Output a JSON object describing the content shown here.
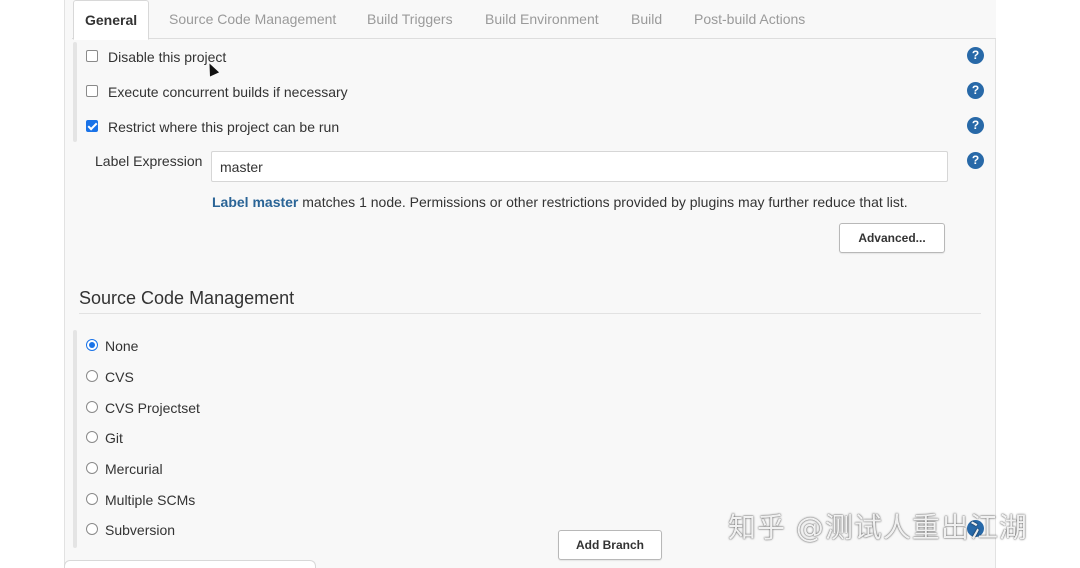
{
  "tabs": [
    {
      "label": "General",
      "active": true
    },
    {
      "label": "Source Code Management",
      "active": false
    },
    {
      "label": "Build Triggers",
      "active": false
    },
    {
      "label": "Build Environment",
      "active": false
    },
    {
      "label": "Build",
      "active": false
    },
    {
      "label": "Post-build Actions",
      "active": false
    }
  ],
  "general": {
    "options": [
      {
        "label": "Disable this project",
        "checked": false
      },
      {
        "label": "Execute concurrent builds if necessary",
        "checked": false
      },
      {
        "label": "Restrict where this project can be run",
        "checked": true
      }
    ],
    "label_expression": {
      "label": "Label Expression",
      "value": "master"
    },
    "info": {
      "link_text": "Label master",
      "rest": " matches 1 node. Permissions or other restrictions provided by plugins may further reduce that list."
    },
    "advanced_button": "Advanced..."
  },
  "scm": {
    "title": "Source Code Management",
    "options": [
      {
        "label": "None",
        "selected": true
      },
      {
        "label": "CVS",
        "selected": false
      },
      {
        "label": "CVS Projectset",
        "selected": false
      },
      {
        "label": "Git",
        "selected": false
      },
      {
        "label": "Mercurial",
        "selected": false
      },
      {
        "label": "Multiple SCMs",
        "selected": false
      },
      {
        "label": "Subversion",
        "selected": false
      }
    ],
    "add_branch_button": "Add Branch"
  },
  "help_icon_text": "?",
  "watermark": "知乎 @测试人重出江湖",
  "colors": {
    "accent": "#1a73e8",
    "help": "#2869a8",
    "link": "#2a6496"
  }
}
